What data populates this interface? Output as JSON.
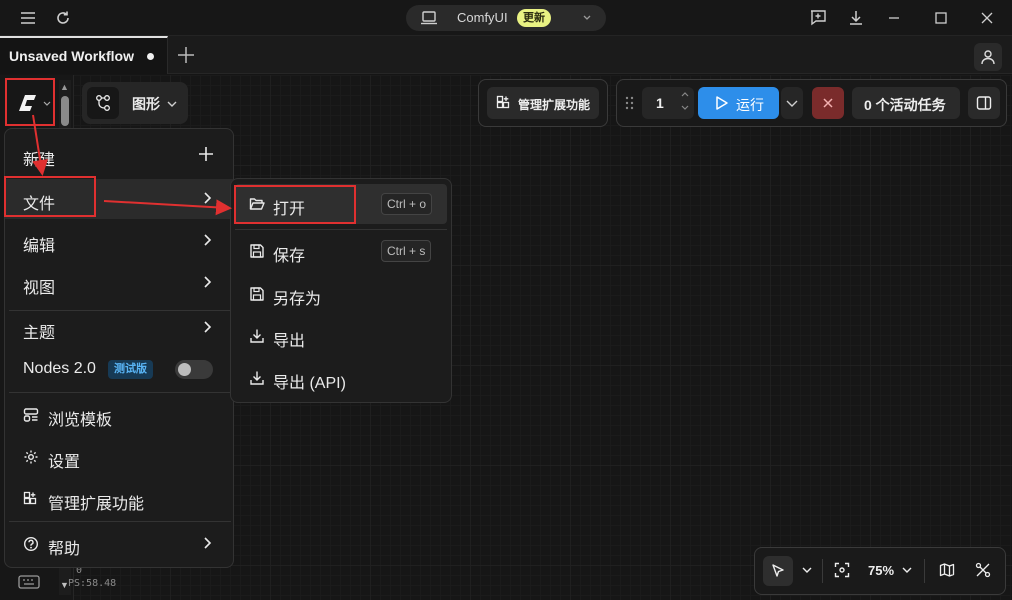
{
  "titlebar": {
    "app_name": "ComfyUI",
    "update_badge": "更新"
  },
  "tabs": [
    {
      "label": "Unsaved Workflow",
      "modified": true
    }
  ],
  "graph_selector": {
    "label": "图形"
  },
  "toolbar": {
    "manage_extensions": "管理扩展功能",
    "batch_count": "1",
    "run_label": "运行",
    "active_tasks": "0 个活动任务"
  },
  "main_menu": {
    "new": "新建",
    "file": "文件",
    "edit": "编辑",
    "view": "视图",
    "theme": "主题",
    "nodes2": "Nodes 2.0",
    "nodes2_badge": "测试版",
    "nodes2_enabled": false,
    "browse_templates": "浏览模板",
    "settings": "设置",
    "manage_extensions": "管理扩展功能",
    "help": "帮助"
  },
  "file_submenu": {
    "open": "打开",
    "open_shortcut": "Ctrl + o",
    "save": "保存",
    "save_shortcut": "Ctrl + s",
    "save_as": "另存为",
    "export": "导出",
    "export_api": "导出 (API)"
  },
  "status": {
    "line1": "0",
    "fps": "PS:58.48"
  },
  "canvas_controls": {
    "zoom": "75%"
  },
  "colors": {
    "accent_blue": "#2d8eea",
    "stop_red": "#7a2b2b",
    "update_badge": "#e9f283",
    "annotation_red": "#e03030"
  }
}
